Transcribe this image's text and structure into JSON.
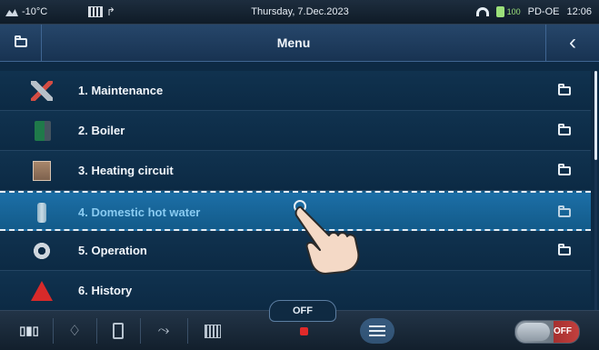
{
  "status_bar": {
    "outdoor_temp": "-10°C",
    "date": "Thursday, 7.Dec.2023",
    "signal_text": "PD-OE",
    "time": "12:06",
    "battery_label": "100"
  },
  "header": {
    "title": "Menu",
    "back_icon": "chevron-left-icon",
    "left_icon": "folder-icon"
  },
  "menu": {
    "items": [
      {
        "label": "1. Maintenance",
        "icon": "tools-icon"
      },
      {
        "label": "2. Boiler",
        "icon": "boiler-icon"
      },
      {
        "label": "3. Heating circuit",
        "icon": "radiator-icon"
      },
      {
        "label": "4. Domestic hot water",
        "icon": "water-tank-icon",
        "selected": true
      },
      {
        "label": "5. Operation",
        "icon": "gear-icon"
      },
      {
        "label": "6. History",
        "icon": "warning-icon"
      }
    ]
  },
  "bottom_bar": {
    "off_label": "OFF",
    "toggle_label": "OFF",
    "icons": [
      "mode-icon",
      "flame-icon",
      "boiler-icon",
      "pump-icon",
      "radiator-icon",
      "menu-icon"
    ]
  },
  "colors": {
    "background": "#0d2a44",
    "selected_row": "#1c6fa7",
    "selected_text": "#89cbf1",
    "accent_red": "#e02a2a"
  }
}
